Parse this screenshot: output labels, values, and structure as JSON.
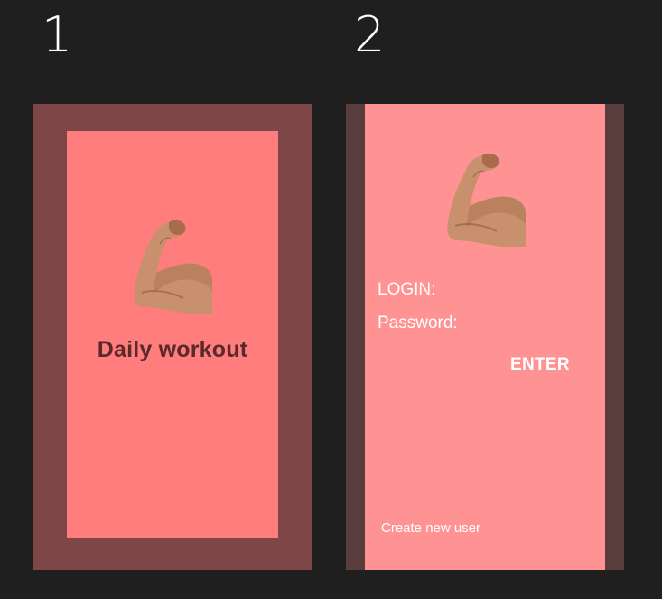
{
  "frames": [
    {
      "number": "1",
      "title": "Daily workout",
      "icon": "flexed-arm-icon"
    },
    {
      "number": "2",
      "icon": "flexed-arm-icon",
      "login_label": "LOGIN:",
      "password_label": "Password:",
      "enter_label": "ENTER",
      "create_user_label": "Create new user"
    }
  ],
  "colors": {
    "canvas": "#1f1f1f",
    "frame1_border": "#7e4646",
    "frame1_screen": "#ff7d7c",
    "frame1_title": "#5a2a2a",
    "frame2_border": "#5a3e3e",
    "frame2_screen": "#ff9393",
    "text_light": "#ffffff"
  }
}
